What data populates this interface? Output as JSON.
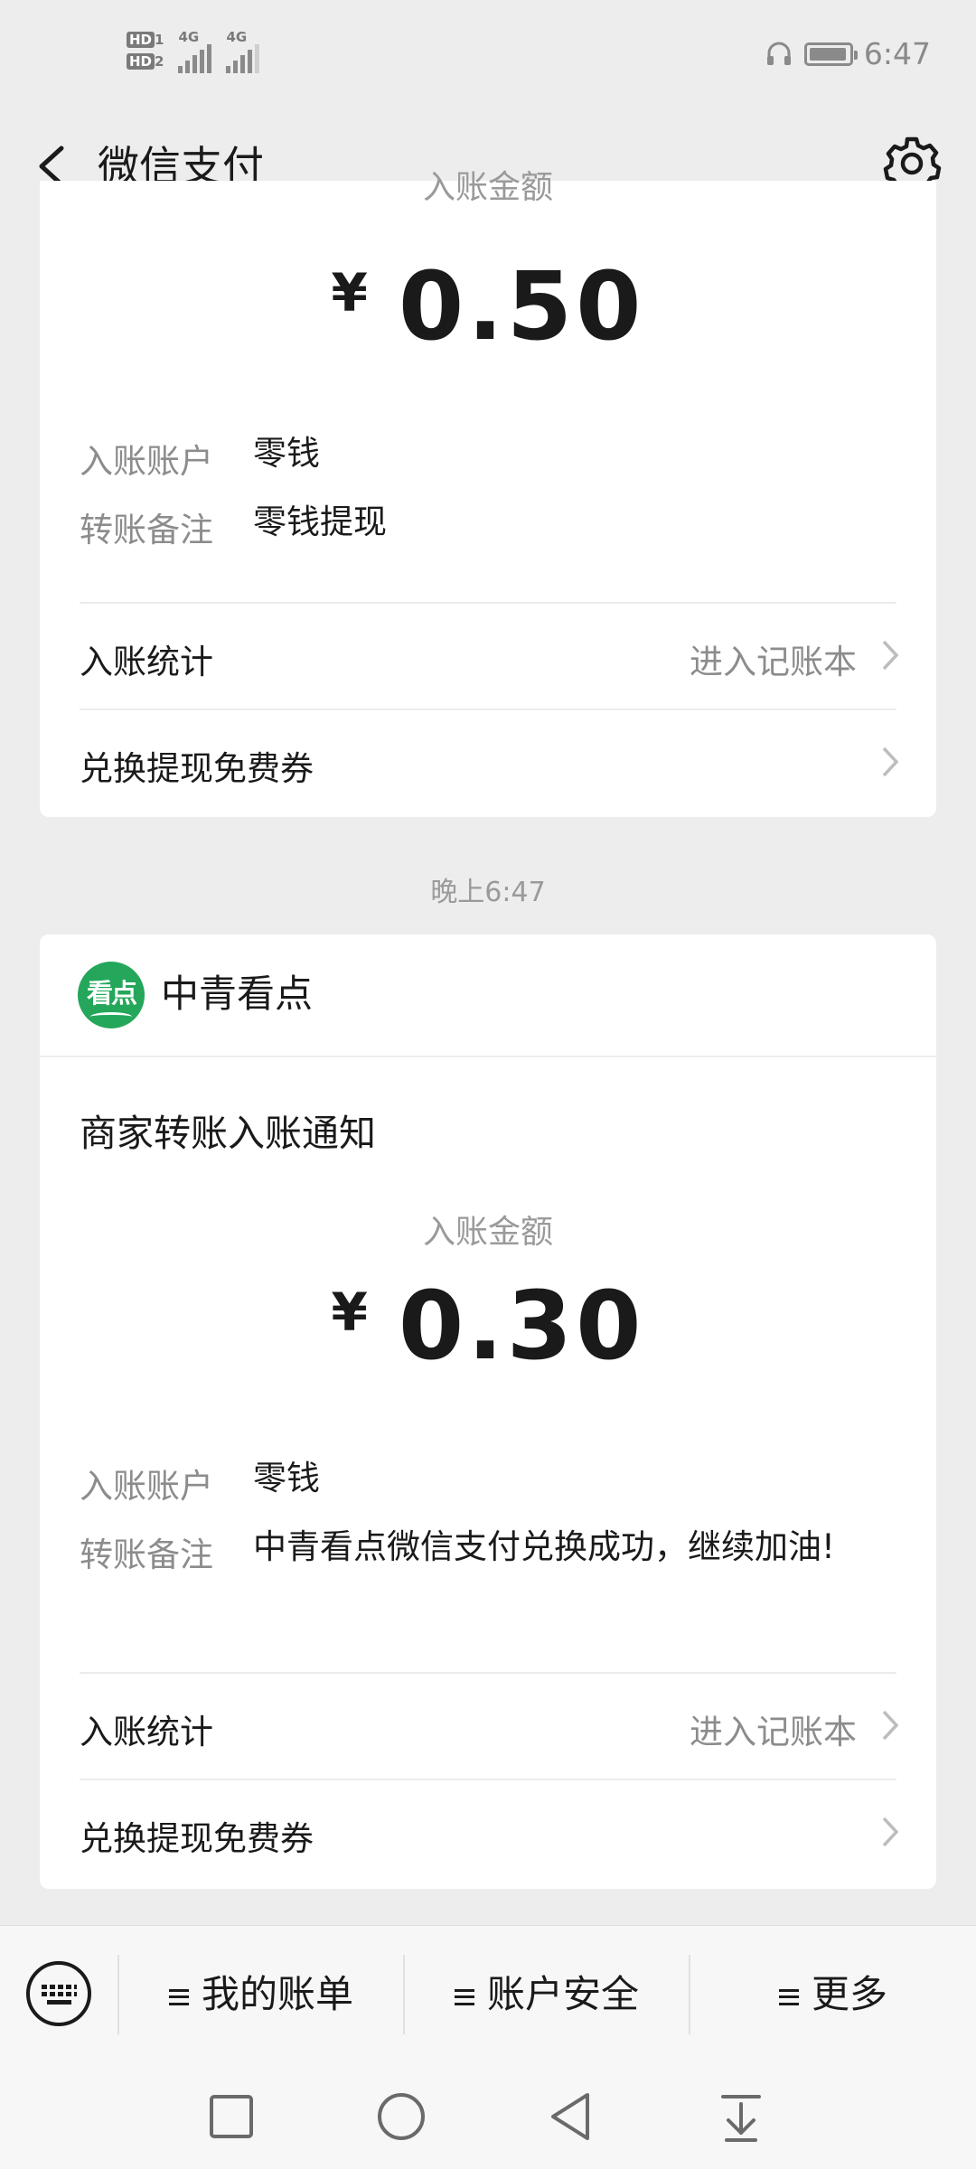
{
  "status_bar": {
    "hd1": "HD",
    "sim1": "1",
    "hd2": "HD",
    "sim2": "2",
    "net1": "4G",
    "net2": "4G",
    "time": "6:47",
    "battery_level": 0.95
  },
  "navbar": {
    "title": "微信支付",
    "back_icon": "chevron-left-icon",
    "settings_icon": "gear-icon"
  },
  "cards": [
    {
      "amount_label": "入账金额",
      "currency": "¥",
      "amount": "0.50",
      "account_label": "入账账户",
      "account": "零钱",
      "remark_label": "转账备注",
      "remark": "零钱提现",
      "stats_label": "入账统计",
      "stats_link": "进入记账本",
      "coupon_label": "兑换提现免费券"
    },
    {
      "merchant": "中青看点",
      "logo_text": "看点",
      "notice_title": "商家转账入账通知",
      "amount_label": "入账金额",
      "currency": "¥",
      "amount": "0.30",
      "account_label": "入账账户",
      "account": "零钱",
      "remark_label": "转账备注",
      "remark": "中青看点微信支付兑换成功，继续加油!",
      "stats_label": "入账统计",
      "stats_link": "进入记账本",
      "coupon_label": "兑换提现免费券"
    }
  ],
  "timestamp": "晚上6:47",
  "menu": {
    "keyboard_icon": "keyboard-icon",
    "items": [
      {
        "label": "我的账单"
      },
      {
        "label": "账户安全"
      },
      {
        "label": "更多"
      }
    ]
  },
  "system_nav": [
    "square-icon",
    "circle-icon",
    "triangle-back-icon",
    "notification-pull-icon"
  ],
  "colors": {
    "background": "#ededed",
    "card": "#ffffff",
    "brand_green": "#24a75a",
    "secondary_text": "#8c8c8c"
  }
}
